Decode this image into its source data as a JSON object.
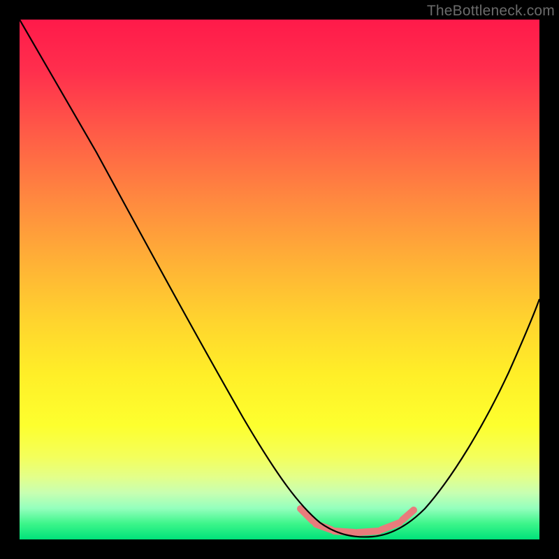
{
  "watermark": "TheBottleneck.com",
  "chart_data": {
    "type": "line",
    "title": "",
    "xlabel": "",
    "ylabel": "",
    "xlim": [
      0,
      100
    ],
    "ylim": [
      0,
      100
    ],
    "series": [
      {
        "name": "curve",
        "x": [
          0,
          3,
          8,
          15,
          25,
          35,
          45,
          52,
          56,
          60,
          64,
          68,
          72,
          76,
          82,
          88,
          94,
          100
        ],
        "y": [
          100,
          98,
          92,
          82,
          65,
          47,
          29,
          16,
          9,
          4,
          1,
          0,
          0,
          2,
          8,
          22,
          40,
          58
        ]
      }
    ],
    "valley_ticks_x": [
      55,
      58,
      62,
      66,
      70,
      74
    ],
    "colors": {
      "curve": "#000000",
      "ticks": "#e87c7c",
      "gradient_top": "#ff1a4a",
      "gradient_bottom": "#00e27a",
      "frame": "#000000"
    }
  }
}
